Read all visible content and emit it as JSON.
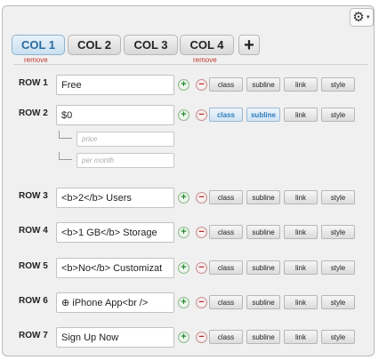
{
  "settings": {
    "gear_icon": "gear-icon",
    "caret_icon": "caret-down-icon"
  },
  "columns": {
    "tabs": [
      "COL 1",
      "COL 2",
      "COL 3",
      "COL 4"
    ],
    "add_label": "+",
    "remove_label": "remove",
    "remove_under": [
      "COL 1",
      "COL 4"
    ]
  },
  "row_actions": {
    "add": "+",
    "remove": "−",
    "options": [
      "class",
      "subline",
      "link",
      "style"
    ]
  },
  "rows": [
    {
      "label": "ROW 1",
      "value": "Free",
      "active_options": []
    },
    {
      "label": "ROW 2",
      "value": "$0",
      "active_options": [
        "class",
        "subline"
      ],
      "sublines": [
        {
          "placeholder": "price"
        },
        {
          "placeholder": "per month"
        }
      ]
    },
    {
      "label": "ROW 3",
      "value": "<b>2</b> Users",
      "active_options": []
    },
    {
      "label": "ROW 4",
      "value": "<b>1 GB</b> Storage",
      "active_options": []
    },
    {
      "label": "ROW 5",
      "value": "<b>No</b> Customizat",
      "active_options": []
    },
    {
      "label": "ROW 6",
      "value": "⊕ iPhone App<br />",
      "active_options": []
    },
    {
      "label": "ROW 7",
      "value": "Sign Up Now",
      "active_options": []
    }
  ]
}
